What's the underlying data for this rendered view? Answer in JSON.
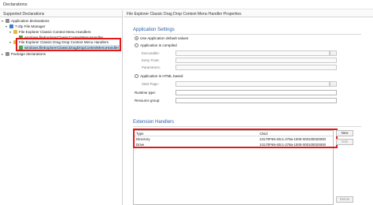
{
  "window": {
    "title": "Declarations"
  },
  "left_pane": {
    "header": "Supported Declarations",
    "tree": [
      {
        "label": "Application declarations",
        "depth": 0,
        "expanded": true,
        "icon": "folder-icon"
      },
      {
        "label": "7-Zip File Manager",
        "depth": 1,
        "expanded": true,
        "icon": "app-icon"
      },
      {
        "label": "File Explorer Classic Context Menu Handlers",
        "depth": 2,
        "expanded": true,
        "icon": "folder-icon"
      },
      {
        "label": "windows.fileExplorerClassicContextMenuHandler",
        "depth": 3,
        "expanded": false,
        "icon": "handler-icon"
      },
      {
        "label": "File Explorer Classic Drag Drop Context Menu Handlers",
        "depth": 2,
        "expanded": true,
        "icon": "folder-icon"
      },
      {
        "label": "windows.fileExplorerClassicDragDropContextMenuHandler",
        "depth": 3,
        "expanded": false,
        "icon": "handler-icon",
        "selected": true
      },
      {
        "label": "Package declarations",
        "depth": 0,
        "expanded": false,
        "icon": "folder-icon"
      }
    ]
  },
  "right_pane": {
    "header": "File Explorer Classic Drag Drop Context Menu Handler Properties",
    "app_settings": {
      "title": "Application Settings",
      "use_default": "Use Application default values",
      "app_compiled": "Application is compiled",
      "executable_label": "Executable:",
      "entry_point_label": "Entry Point:",
      "parameters_label": "Parameters:",
      "app_html": "Application is HTML based",
      "start_page_label": "Start Page:",
      "runtime_type_label": "Runtime type:",
      "resource_group_label": "Resource group:",
      "browse_label": "..."
    },
    "extension_handlers": {
      "title": "Extension Handlers",
      "columns": [
        "Type",
        "Clsid"
      ],
      "rows": [
        {
          "type": "Directory",
          "clsid": "23170F69-40c1-278a-1000-000100020000"
        },
        {
          "type": "Drive",
          "clsid": "23170F69-40c1-278a-1000-000100020000"
        }
      ],
      "buttons": {
        "new": "New",
        "edit": "Edit",
        "delete": "Delete"
      }
    }
  },
  "colors": {
    "accent": "#2a5fa8",
    "highlight_border": "#e01a1a",
    "selection": "#cde4f7"
  }
}
